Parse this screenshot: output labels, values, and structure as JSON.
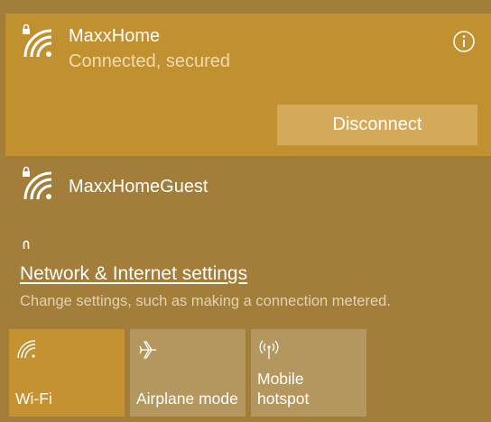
{
  "networks": {
    "connected": {
      "name": "MaxxHome",
      "status": "Connected, secured",
      "disconnect_label": "Disconnect",
      "info_icon": "info-icon",
      "wifi_icon": "wifi-secured-icon"
    },
    "guest": {
      "name": "MaxxHomeGuest",
      "wifi_icon": "wifi-secured-icon"
    }
  },
  "settings": {
    "link_label": "Network & Internet settings",
    "description": "Change settings, such as making a connection metered."
  },
  "quick_actions": [
    {
      "label": "Wi-Fi",
      "icon": "wifi-icon",
      "active": true
    },
    {
      "label": "Airplane mode",
      "icon": "airplane-icon",
      "active": false
    },
    {
      "label": "Mobile hotspot",
      "icon": "hotspot-icon",
      "active": false
    }
  ],
  "colors": {
    "panel_background": "#a27e3a",
    "connected_background": "#c1902f",
    "disconnect_button": "#d5aa5a",
    "tile_active": "#c49230",
    "tile_inactive": "#b3975f",
    "text_primary": "#ffffff",
    "text_secondary": "#f0dcb0"
  }
}
